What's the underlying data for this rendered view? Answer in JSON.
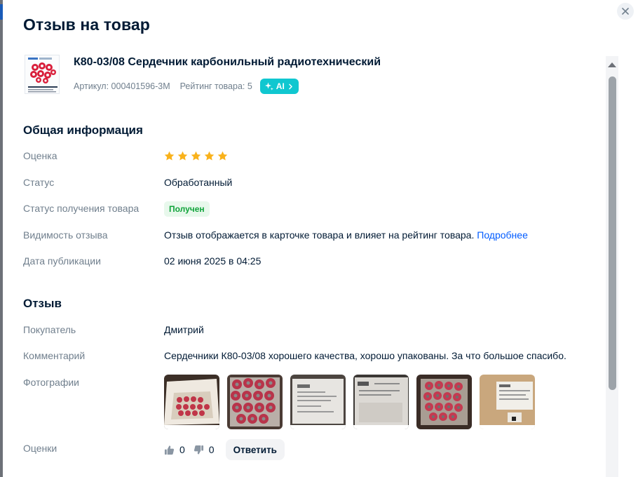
{
  "modal": {
    "title": "Отзыв на товар",
    "close_icon": "close-icon"
  },
  "product": {
    "name": "К80-03/08 Сердечник карбонильный радиотехнический",
    "article": "Артикул: 000401596-3M",
    "rating": "Рейтинг товара: 5",
    "ai_badge": "AI"
  },
  "general": {
    "title": "Общая информация",
    "rating_label": "Оценка",
    "rating_value": 5,
    "rating_max": 5,
    "status_label": "Статус",
    "status_value": "Обработанный",
    "receipt_label": "Статус получения товара",
    "receipt_value": "Получен",
    "visibility_label": "Видимость отзыва",
    "visibility_value": "Отзыв отображается в карточке товара и влияет на рейтинг товара.",
    "visibility_link": "Подробнее",
    "date_label": "Дата публикации",
    "date_value": "02 июня 2025 в 04:25"
  },
  "review": {
    "title": "Отзыв",
    "buyer_label": "Покупатель",
    "buyer_value": "Дмитрий",
    "comment_label": "Комментарий",
    "comment_value": "Сердечники К80-03/08 хорошего качества, хорошо упакованы. За что большое спасибо.",
    "photos_label": "Фотографии",
    "photo_count": 6,
    "ratings_label": "Оценки",
    "likes": "0",
    "dislikes": "0",
    "reply_button": "Ответить"
  },
  "colors": {
    "accent_teal": "#10c7d0",
    "star": "#f9b21b",
    "link": "#005bff",
    "status_green": "#10a33a",
    "label_gray": "#707f8d",
    "text_dark": "#001a34"
  }
}
